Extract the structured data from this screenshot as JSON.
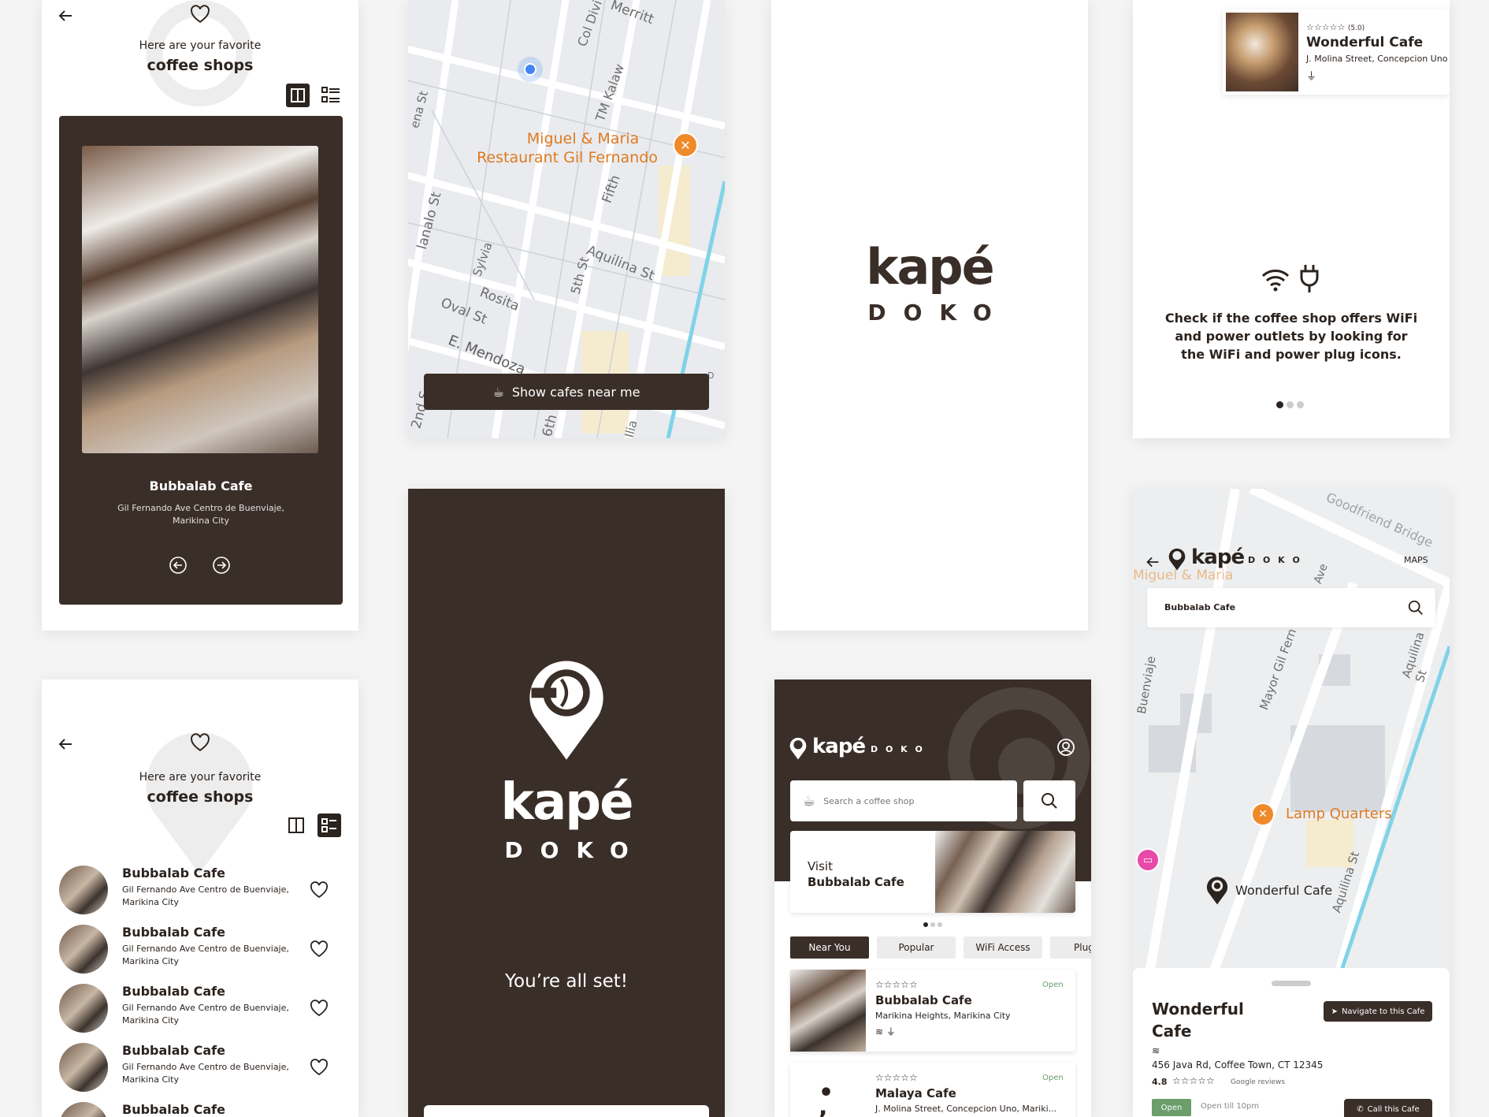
{
  "screens": {
    "favorites_card": {
      "heading_line1": "Here are your favorite",
      "heading_line2": "coffee shops",
      "cafe_name": "Bubbalab Cafe",
      "address_line1": "Gil Fernando Ave Centro de Buenviaje,",
      "address_line2": "Marikina City"
    },
    "map_screen": {
      "show_cafes_label": "Show cafes near me",
      "streets": [
        "Merritt",
        "Col Divi",
        "TM Kalaw",
        "Fifth",
        "Aquilina St",
        "5th St",
        "Sylvia",
        "Rosita",
        "Oval St",
        "E. Mendoza",
        "lanalo St",
        "ena St",
        "2nd S",
        "6th",
        "Ilia",
        "D"
      ],
      "poi_label_line1": "Miguel & Maria",
      "poi_label_line2": "Restaurant Gil Fernando"
    },
    "splash": {
      "brand": "kapé",
      "sub": "DOKO"
    },
    "onboarding": {
      "rating": "(5.0)",
      "cafe_name": "Wonderful Cafe",
      "cafe_address": "J. Molina Street, Concepcion Uno",
      "body": "Check if the coffee shop offers WiFi and power outlets by looking for the WiFi and power plug icons."
    },
    "favorites_list": {
      "heading_line1": "Here are your favorite",
      "heading_line2": "coffee shops",
      "items": [
        {
          "name": "Bubbalab Cafe",
          "address1": "Gil Fernando Ave Centro de Buenviaje,",
          "address2": "Marikina City"
        },
        {
          "name": "Bubbalab Cafe",
          "address1": "Gil Fernando Ave Centro de Buenviaje,",
          "address2": "Marikina City"
        },
        {
          "name": "Bubbalab Cafe",
          "address1": "Gil Fernando Ave Centro de Buenviaje,",
          "address2": "Marikina City"
        },
        {
          "name": "Bubbalab Cafe",
          "address1": "Gil Fernando Ave Centro de Buenviaje,",
          "address2": "Marikina City"
        },
        {
          "name": "Bubbalab Cafe",
          "address1": "",
          "address2": ""
        }
      ]
    },
    "all_set": {
      "brand": "kapé",
      "sub": "DOKO",
      "message": "You’re all set!"
    },
    "home": {
      "brand": "kapé",
      "sub": "D O K O",
      "search_placeholder": "Search a coffee shop",
      "visit_label": "Visit",
      "visit_cafe": "Bubbalab Cafe",
      "tabs": [
        "Near You",
        "Popular",
        "WiFi Access",
        "Plug"
      ],
      "results": [
        {
          "name": "Bubbalab Cafe",
          "address": "Marikina Heights, Marikina City",
          "status": "Open"
        },
        {
          "name": "Malaya Cafe",
          "address": "J. Molina Street, Concepcion Uno, Mariki...",
          "status": "Open"
        }
      ]
    },
    "map_detail": {
      "brand": "kapé",
      "sub": "D O K O",
      "maps_label": "MAPS",
      "search_value": "Bubbalab Cafe",
      "streets": [
        "Goodfriend Bridge",
        "Miguel & Maria",
        "Buenviaje",
        "Mayor Gil Fern",
        "Aquilina St",
        "Aquilina St",
        "Ave"
      ],
      "poi1": "Lamp Quarters",
      "poi2": "Wonderful Cafe",
      "cafe_title_line1": "Wonderful",
      "cafe_title_line2": "Cafe",
      "navigate_label": "Navigate to this Cafe",
      "address": "456 Java Rd, Coffee Town, CT 12345",
      "rating": "4.8",
      "reviews_label": "Google reviews",
      "open_label": "Open",
      "open_until": "Open till 10pm",
      "call_label": "Call this Cafe"
    }
  }
}
